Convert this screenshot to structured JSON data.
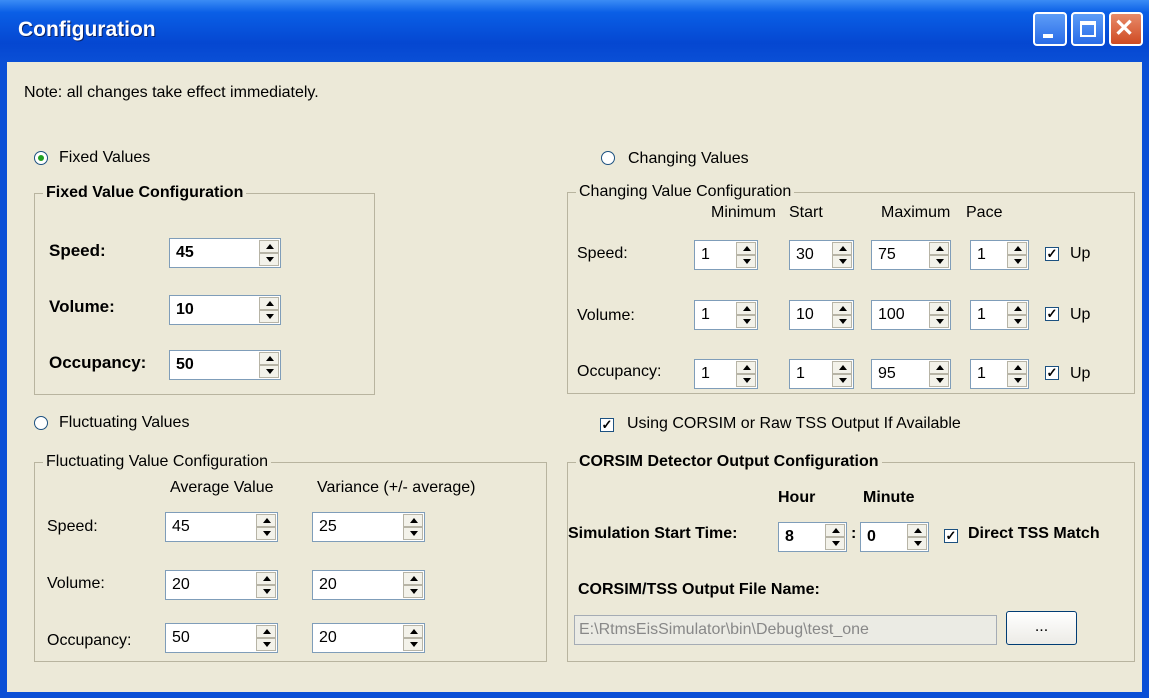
{
  "window": {
    "title": "Configuration"
  },
  "note": "Note: all changes take effect immediately.",
  "fixed": {
    "radio_label": "Fixed Values",
    "group_title": "Fixed Value Configuration",
    "speed_label": "Speed:",
    "speed_value": "45",
    "volume_label": "Volume:",
    "volume_value": "10",
    "occupancy_label": "Occupancy:",
    "occupancy_value": "50"
  },
  "changing": {
    "radio_label": "Changing Values",
    "group_title": "Changing Value Configuration",
    "headers": {
      "minimum": "Minimum",
      "start": "Start",
      "maximum": "Maximum",
      "pace": "Pace"
    },
    "up_label": "Up",
    "rows": [
      {
        "label": "Speed:",
        "min": "1",
        "start": "30",
        "max": "75",
        "pace": "1"
      },
      {
        "label": "Volume:",
        "min": "1",
        "start": "10",
        "max": "100",
        "pace": "1"
      },
      {
        "label": "Occupancy:",
        "min": "1",
        "start": "1",
        "max": "95",
        "pace": "1"
      }
    ]
  },
  "fluctuating": {
    "radio_label": "Fluctuating Values",
    "group_title": "Fluctuating Value Configuration",
    "headers": {
      "average": "Average Value",
      "variance": "Variance (+/- average)"
    },
    "rows": [
      {
        "label": "Speed:",
        "avg": "45",
        "var": "25"
      },
      {
        "label": "Volume:",
        "avg": "20",
        "var": "20"
      },
      {
        "label": "Occupancy:",
        "avg": "50",
        "var": "20"
      }
    ]
  },
  "corsim": {
    "using_label": "Using CORSIM or Raw TSS Output If Available",
    "group_title": "CORSIM Detector Output Configuration",
    "hour_label": "Hour",
    "minute_label": "Minute",
    "start_time_label": "Simulation Start Time:",
    "hour_value": "8",
    "colon": ":",
    "minute_value": "0",
    "direct_match_label": "Direct TSS Match",
    "file_label": "CORSIM/TSS Output File Name:",
    "file_value": "E:\\RtmsEisSimulator\\bin\\Debug\\test_one",
    "browse_label": "..."
  },
  "icons": [
    "minimize-icon",
    "maximize-icon",
    "close-icon",
    "check-icon"
  ],
  "colors": {
    "title_bar": "#0a4fd6",
    "client": "#ece9d8",
    "close_button": "#cf4a22"
  }
}
